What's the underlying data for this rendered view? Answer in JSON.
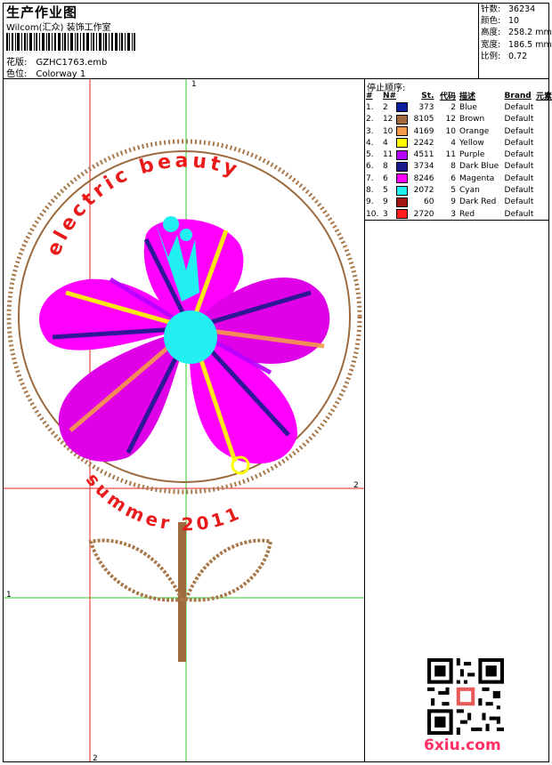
{
  "header": {
    "title": "生产作业图",
    "company": "Wilcom(汇众) 装饰工作室",
    "design_label": "花版:",
    "design_value": "GZHC1763.emb",
    "colorway_label": "色位:",
    "colorway_value": "Colorway 1"
  },
  "stats": [
    {
      "label": "针数:",
      "value": "36234"
    },
    {
      "label": "颜色:",
      "value": "10"
    },
    {
      "label": "高度:",
      "value": "258.2 mm"
    },
    {
      "label": "宽度:",
      "value": "186.5 mm"
    },
    {
      "label": "比例:",
      "value": "0.72"
    }
  ],
  "sequence": {
    "title": "停止顺序:",
    "headers": [
      "#",
      "N#",
      "St.",
      "代码",
      "描述",
      "Brand",
      "元素"
    ],
    "rows": [
      {
        "idx": "1.",
        "n": "2",
        "st": "373",
        "code": "2",
        "desc": "Blue",
        "brand": "Default",
        "color": "#0b1f9e"
      },
      {
        "idx": "2.",
        "n": "12",
        "st": "8105",
        "code": "12",
        "desc": "Brown",
        "brand": "Default",
        "color": "#a06a3c"
      },
      {
        "idx": "3.",
        "n": "10",
        "st": "4169",
        "code": "10",
        "desc": "Orange",
        "brand": "Default",
        "color": "#f59a4a"
      },
      {
        "idx": "4.",
        "n": "4",
        "st": "2242",
        "code": "4",
        "desc": "Yellow",
        "brand": "Default",
        "color": "#ffff00"
      },
      {
        "idx": "5.",
        "n": "11",
        "st": "4511",
        "code": "11",
        "desc": "Purple",
        "brand": "Default",
        "color": "#b400ff"
      },
      {
        "idx": "6.",
        "n": "8",
        "st": "3734",
        "code": "8",
        "desc": "Dark Blue",
        "brand": "Default",
        "color": "#1a1a8c"
      },
      {
        "idx": "7.",
        "n": "6",
        "st": "8246",
        "code": "6",
        "desc": "Magenta",
        "brand": "Default",
        "color": "#ff00ff"
      },
      {
        "idx": "8.",
        "n": "5",
        "st": "2072",
        "code": "5",
        "desc": "Cyan",
        "brand": "Default",
        "color": "#22f0f0"
      },
      {
        "idx": "9.",
        "n": "9",
        "st": "60",
        "code": "9",
        "desc": "Dark Red",
        "brand": "Default",
        "color": "#a01414"
      },
      {
        "idx": "10.",
        "n": "3",
        "st": "2720",
        "code": "3",
        "desc": "Red",
        "brand": "Default",
        "color": "#ff1c1c"
      }
    ]
  },
  "design": {
    "text_top": "electric beauty",
    "text_bottom": "summer 2011",
    "guide_labels": {
      "green_top": "1",
      "green_left": "1",
      "red_right": "2",
      "red_bottom": "2"
    }
  },
  "watermark": "6xiu.com"
}
